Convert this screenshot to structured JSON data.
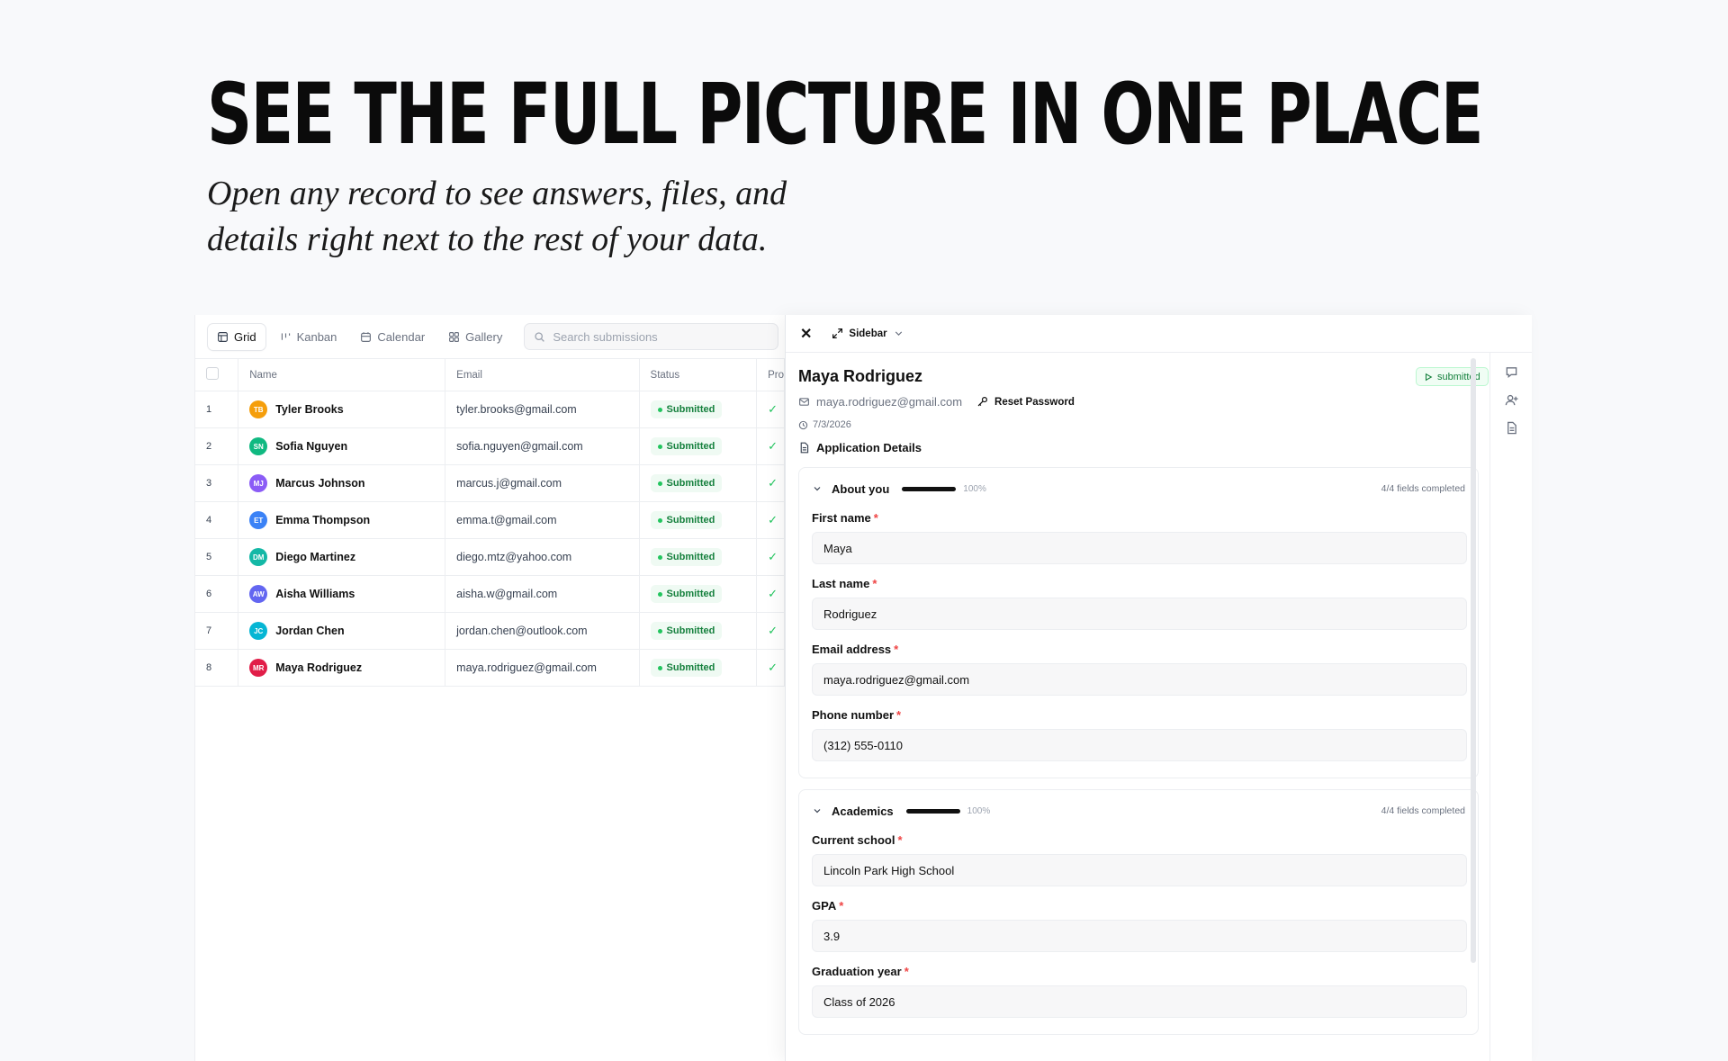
{
  "hero": {
    "headline": "SEE THE FULL PICTURE IN ONE PLACE",
    "subhead_line1": "Open any record to see answers, files, and",
    "subhead_line2": "details right next to the rest of your data."
  },
  "toolbar": {
    "views": [
      {
        "label": "Grid",
        "active": true
      },
      {
        "label": "Kanban",
        "active": false
      },
      {
        "label": "Calendar",
        "active": false
      },
      {
        "label": "Gallery",
        "active": false
      }
    ],
    "search_placeholder": "Search submissions"
  },
  "grid": {
    "columns": [
      "Name",
      "Email",
      "Status",
      "Pro"
    ],
    "rows": [
      {
        "index": "1",
        "initials": "TB",
        "avatar_color": "#f59e0b",
        "name": "Tyler Brooks",
        "email": "tyler.brooks@gmail.com",
        "status": "Submitted",
        "check": "✓"
      },
      {
        "index": "2",
        "initials": "SN",
        "avatar_color": "#10b981",
        "name": "Sofia Nguyen",
        "email": "sofia.nguyen@gmail.com",
        "status": "Submitted",
        "check": "✓"
      },
      {
        "index": "3",
        "initials": "MJ",
        "avatar_color": "#8b5cf6",
        "name": "Marcus Johnson",
        "email": "marcus.j@gmail.com",
        "status": "Submitted",
        "check": "✓"
      },
      {
        "index": "4",
        "initials": "ET",
        "avatar_color": "#3b82f6",
        "name": "Emma Thompson",
        "email": "emma.t@gmail.com",
        "status": "Submitted",
        "check": "✓"
      },
      {
        "index": "5",
        "initials": "DM",
        "avatar_color": "#14b8a6",
        "name": "Diego Martinez",
        "email": "diego.mtz@yahoo.com",
        "status": "Submitted",
        "check": "✓"
      },
      {
        "index": "6",
        "initials": "AW",
        "avatar_color": "#6366f1",
        "name": "Aisha Williams",
        "email": "aisha.w@gmail.com",
        "status": "Submitted",
        "check": "✓"
      },
      {
        "index": "7",
        "initials": "JC",
        "avatar_color": "#06b6d4",
        "name": "Jordan Chen",
        "email": "jordan.chen@outlook.com",
        "status": "Submitted",
        "check": "✓"
      },
      {
        "index": "8",
        "initials": "MR",
        "avatar_color": "#e11d48",
        "name": "Maya Rodriguez",
        "email": "maya.rodriguez@gmail.com",
        "status": "Submitted",
        "check": "✓"
      }
    ]
  },
  "detail": {
    "close_glyph": "✕",
    "sidebar_label": "Sidebar",
    "name": "Maya Rodriguez",
    "status_badge": "submitted",
    "email": "maya.rodriguez@gmail.com",
    "reset_password_label": "Reset Password",
    "date": "7/3/2026",
    "application_details_label": "Application Details",
    "sections": [
      {
        "title": "About you",
        "percent": "100%",
        "progress": 1.0,
        "completed": "4/4 fields completed",
        "fields": [
          {
            "label": "First name",
            "required": "*",
            "value": "Maya"
          },
          {
            "label": "Last name",
            "required": "*",
            "value": "Rodriguez"
          },
          {
            "label": "Email address",
            "required": "*",
            "value": "maya.rodriguez@gmail.com"
          },
          {
            "label": "Phone number",
            "required": "*",
            "value": "(312) 555-0110"
          }
        ]
      },
      {
        "title": "Academics",
        "percent": "100%",
        "progress": 1.0,
        "completed": "4/4 fields completed",
        "fields": [
          {
            "label": "Current school",
            "required": "*",
            "value": "Lincoln Park High School"
          },
          {
            "label": "GPA",
            "required": "*",
            "value": "3.9"
          },
          {
            "label": "Graduation year",
            "required": "*",
            "value": "Class of 2026"
          }
        ]
      }
    ]
  },
  "icons": {
    "grid_view": "table-icon",
    "kanban_view": "kanban-icon",
    "calendar_view": "calendar-icon",
    "gallery_view": "gallery-icon",
    "search": "search-icon",
    "close": "close-icon",
    "expand": "expand-icon",
    "mail": "mail-icon",
    "key": "key-icon",
    "clock": "clock-icon",
    "document": "document-icon",
    "comment": "comment-icon",
    "add_user": "add-user-icon"
  },
  "colors": {
    "status_green": "#15803d",
    "required_red": "#ef4444"
  }
}
